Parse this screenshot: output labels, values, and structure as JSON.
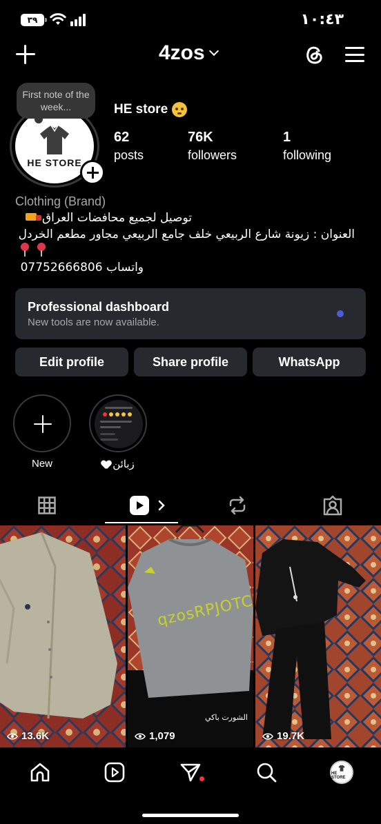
{
  "status_bar": {
    "time": "١٠:٤٣",
    "battery": "٣٩"
  },
  "header": {
    "username": "4zos"
  },
  "profile": {
    "note": "First note of the week...",
    "avatar_brand": "HE STORE",
    "display_name": "HE store",
    "stats": [
      {
        "value": "62",
        "label": "posts"
      },
      {
        "value": "76K",
        "label": "followers"
      },
      {
        "value": "1",
        "label": "following"
      }
    ],
    "category": "Clothing (Brand)",
    "bio": [
      "توصيل لجميع محافضات العراق",
      "العنوان : زيونة شارع الربيعي خلف جامع الربيعي مجاور مطعم الخردل",
      "واتساب 07752666806"
    ]
  },
  "dashboard": {
    "title": "Professional dashboard",
    "subtitle": "New tools are now available."
  },
  "buttons": {
    "edit": "Edit profile",
    "share": "Share profile",
    "whatsapp": "WhatsApp"
  },
  "highlights": [
    {
      "label": "New"
    },
    {
      "label": "زبائن"
    }
  ],
  "grid": [
    {
      "views": "13.6K"
    },
    {
      "views": "1,079",
      "caption": "الشورت باكي",
      "shirt_text": "qzosRPJOTCE"
    },
    {
      "views": "19.7K"
    }
  ],
  "mini_avatar_brand": "HE STORE",
  "colors": {
    "background": "#000000",
    "card": "#262a2f",
    "accent_dot": "#4f5bd5",
    "notification": "#ff3040"
  }
}
